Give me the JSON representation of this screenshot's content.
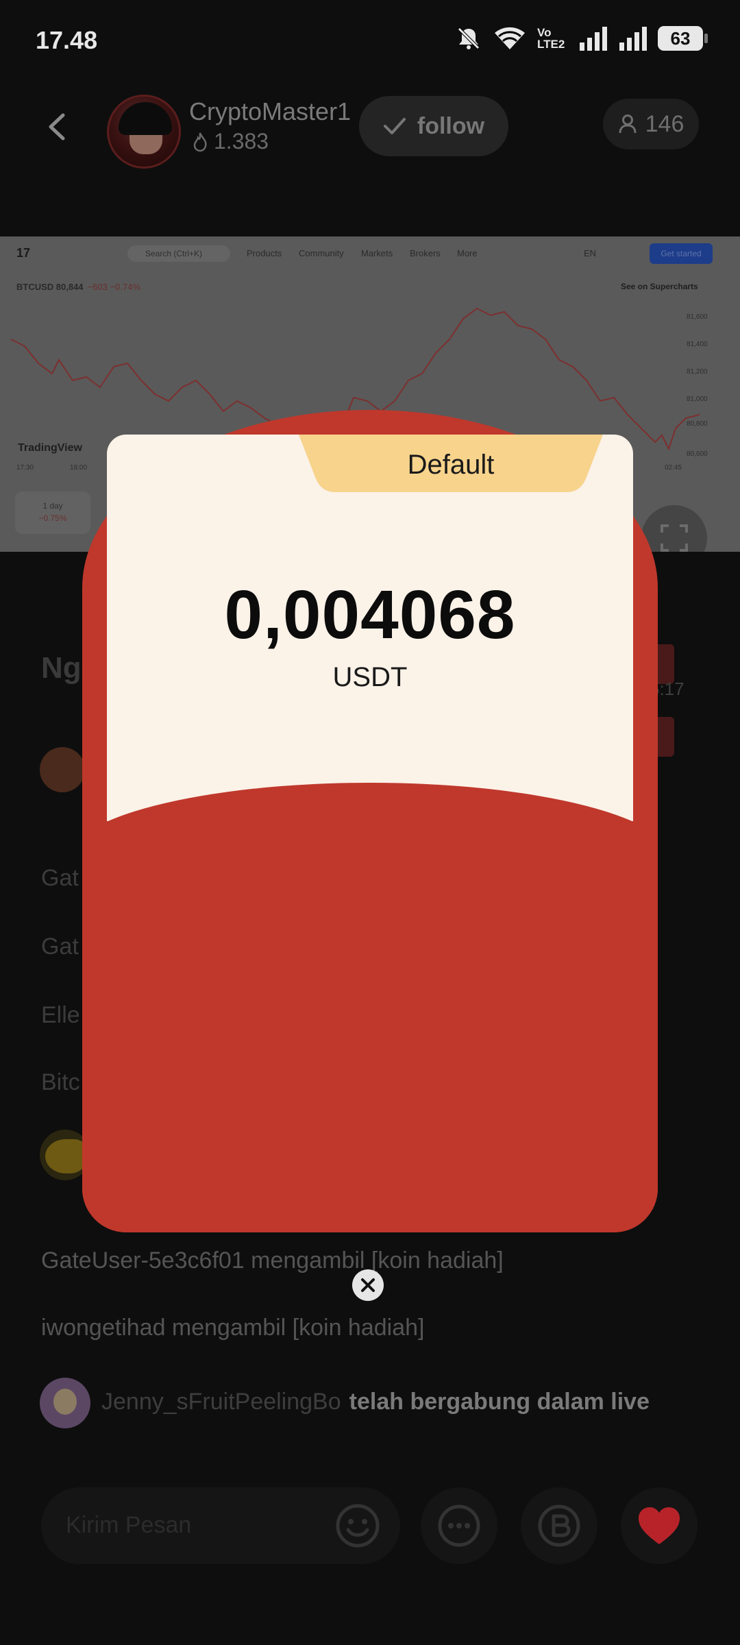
{
  "status_bar": {
    "time": "17.48",
    "battery": "63",
    "volte": "Vo LTE2"
  },
  "header": {
    "host_name": "CryptoMaster1",
    "host_fans": "1.383",
    "follow_label": "follow",
    "viewers": "146"
  },
  "chart_embed": {
    "search_placeholder": "Search (Ctrl+K)",
    "nav": [
      "Products",
      "Community",
      "Markets",
      "Brokers",
      "More"
    ],
    "lang": "EN",
    "get_started": "Get started",
    "ticker": "BTCUSD 80,844",
    "ticker_change": "−603 −0.74%",
    "supercharts": "See on Supercharts",
    "brand": "TradingView",
    "range_label": "1 day",
    "range_change": "−0.75%",
    "y_labels": [
      "81,600",
      "81,400",
      "81,200",
      "81,000",
      "80,800",
      "80,600"
    ],
    "x_labels": [
      "17:30",
      "18:00",
      "02:45"
    ]
  },
  "feed": {
    "title_fragment": "Ngo",
    "side_time": "5:17",
    "lines": [
      "Gat",
      "Gat",
      "Elle",
      "Bitc"
    ],
    "claim_1": "GateUser-5e3c6f01 mengambil [koin hadiah]",
    "claim_2": "iwongetihad mengambil [koin hadiah]",
    "join_user": "Jenny_sFruitPeelingBo",
    "join_action": "telah bergabung dalam live"
  },
  "bottom_bar": {
    "message_placeholder": "Kirim Pesan"
  },
  "packet": {
    "tag": "Default",
    "amount": "0,004068",
    "currency": "USDT"
  },
  "colors": {
    "packet_red": "#c0382c",
    "card_cream": "#fbf2e8",
    "tag_yellow": "#f7d38c",
    "like_red": "#b8232a"
  }
}
